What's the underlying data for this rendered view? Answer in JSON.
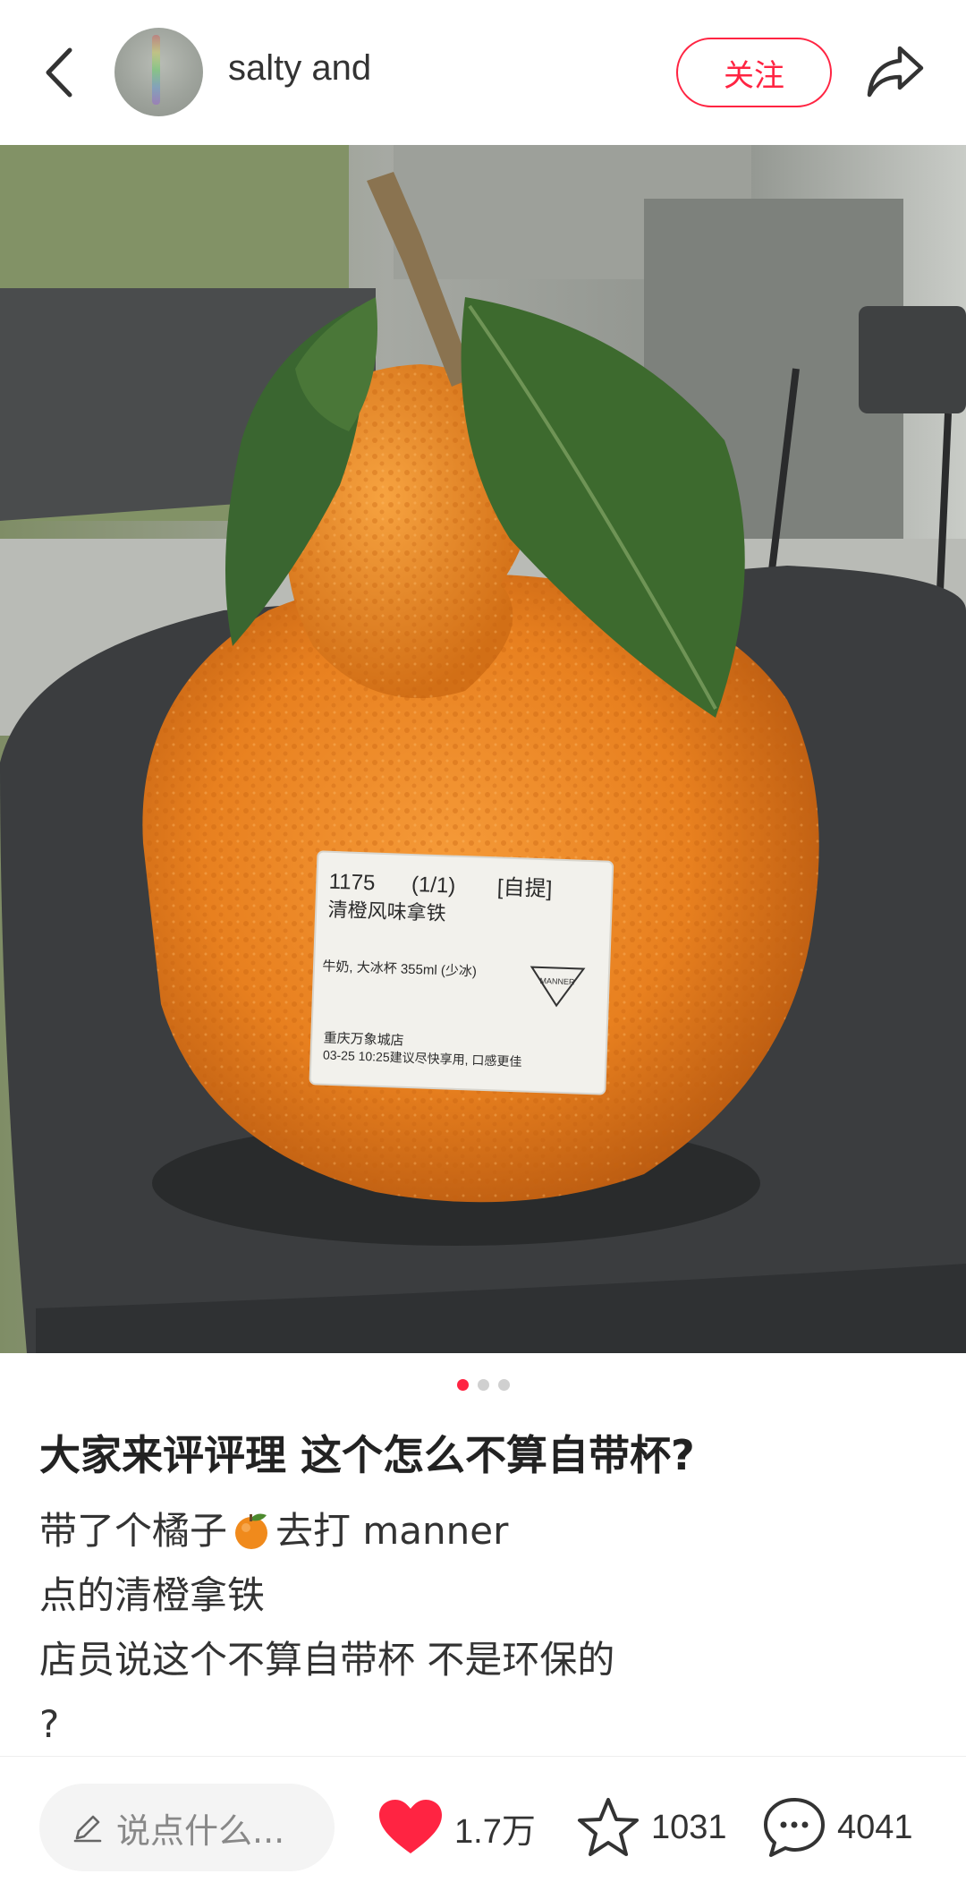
{
  "header": {
    "username": "salty and",
    "follow_label": "关注"
  },
  "post": {
    "image_pager": {
      "total": 3,
      "active": 1
    },
    "sticker": {
      "line1": "1175",
      "line1b": "(1/1)",
      "line1c": "[自提]",
      "line2": "清橙风味拿铁",
      "line3": "牛奶, 大冰杯 355ml (少冰)",
      "line4": "重庆万象城店",
      "line5": "03-25 10:25建议尽快享用, 口感更佳",
      "logo": "MANNER"
    },
    "title": "大家来评评理 这个怎么不算自带杯?",
    "body": {
      "line1_a": "带了个橘子",
      "line1_emoji": "tangerine-emoji",
      "line1_b": "去打 manner",
      "line2": "点的清橙拿铁",
      "line3": "店员说这个不算自带杯 不是环保的",
      "line4": "?"
    }
  },
  "bottom_bar": {
    "comment_placeholder": "说点什么...",
    "likes": "1.7万",
    "favorites": "1031",
    "comments": "4041",
    "like_color": "#ff2442"
  },
  "icons": [
    "back-icon",
    "share-icon",
    "pencil-icon",
    "heart-icon",
    "star-icon",
    "comment-icon"
  ]
}
